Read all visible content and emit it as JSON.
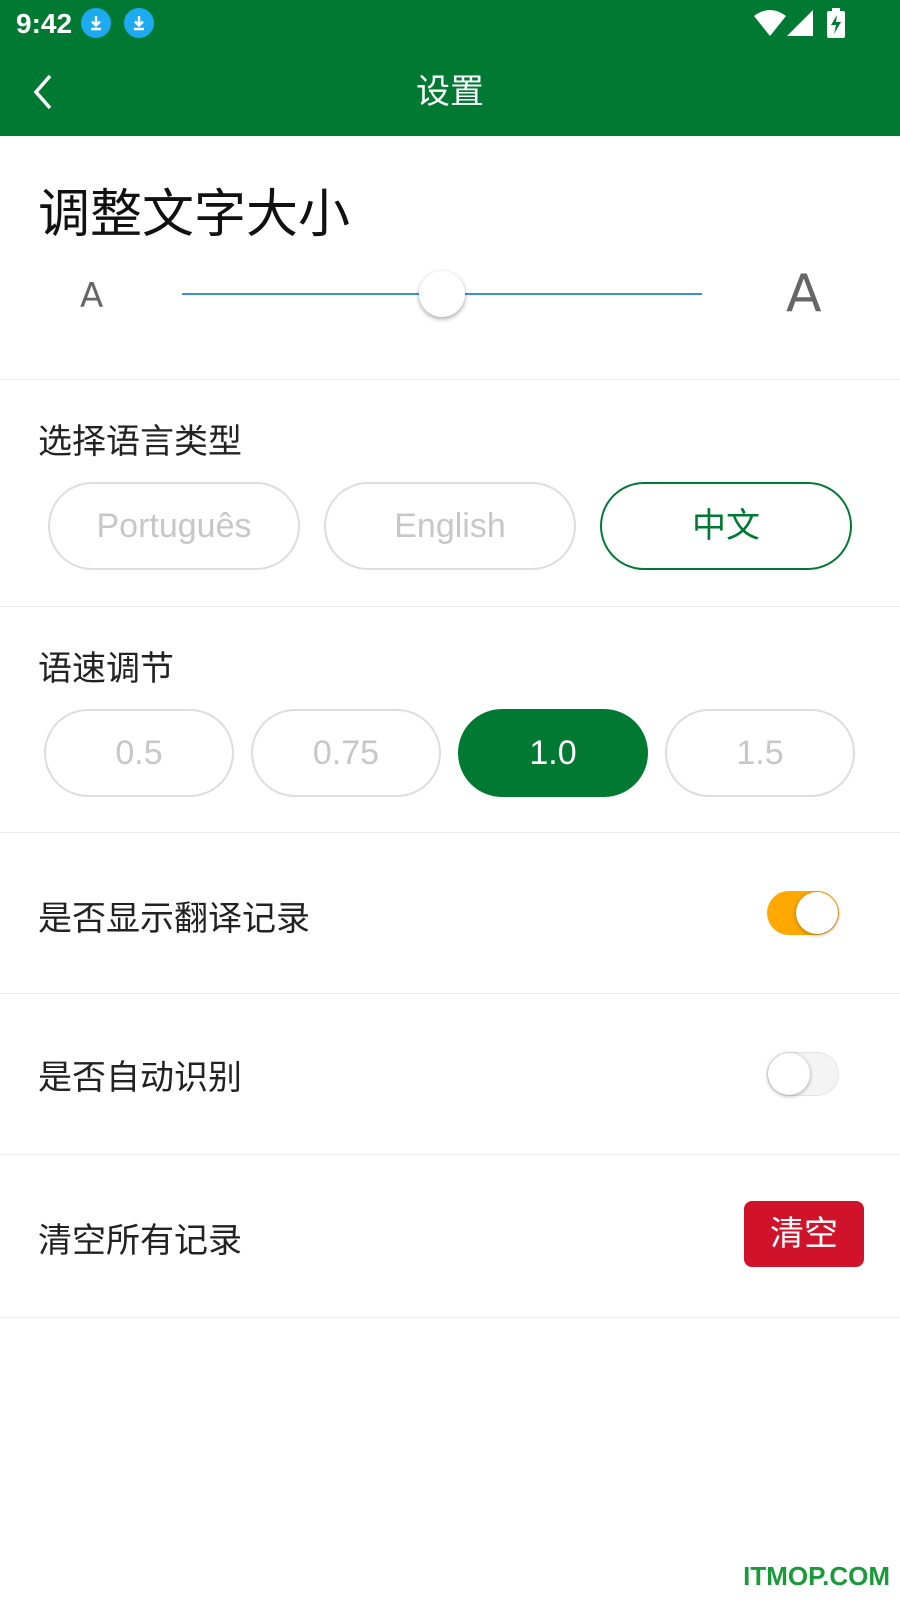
{
  "status_bar": {
    "time": "9:42",
    "icons": [
      "download-icon",
      "download-icon",
      "wifi-icon",
      "signal-icon",
      "battery-charging-icon"
    ]
  },
  "app_bar": {
    "title": "设置",
    "back_icon": "chevron-left-icon"
  },
  "font_size": {
    "title": "调整文字大小",
    "small_label": "A",
    "large_label": "A",
    "slider_level": 0.5
  },
  "language": {
    "title": "选择语言类型",
    "options": [
      "Português",
      "English",
      "中文"
    ],
    "selected": "中文"
  },
  "speed": {
    "title": "语速调节",
    "options": [
      "0.5",
      "0.75",
      "1.0",
      "1.5"
    ],
    "selected": "1.0"
  },
  "settings": {
    "show_history": {
      "label": "是否显示翻译记录",
      "enabled": true
    },
    "auto_detect": {
      "label": "是否自动识别",
      "enabled": false
    },
    "clear_all": {
      "label": "清空所有记录",
      "button_label": "清空"
    }
  },
  "watermark": "ITMOP.COM",
  "colors": {
    "brand_green": "#007a33",
    "toggle_on": "#ffa900",
    "danger_red": "#d0132a",
    "slider_blue": "#3d8fe0"
  }
}
